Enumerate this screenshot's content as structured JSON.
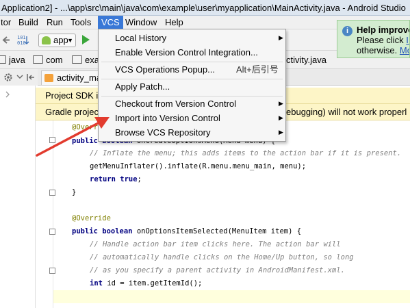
{
  "window": {
    "title": "Application2] - ...\\app\\src\\main\\java\\com\\example\\user\\myapplication\\MainActivity.java - Android Studio"
  },
  "menubar": {
    "items": [
      "tor",
      "Build",
      "Run",
      "Tools",
      "VCS",
      "Window",
      "Help"
    ]
  },
  "toolbar": {
    "run_config": "app"
  },
  "breadcrumbs": {
    "items": [
      "java",
      "com",
      "exa",
      "ctivity.java"
    ]
  },
  "editor_tab": {
    "label": "activity_ma"
  },
  "notifications": {
    "sdk": "Project SDK i",
    "gradle": "Gradle projec",
    "gradle_tail": "ebugging) will not work properl"
  },
  "help_popup": {
    "title": "Help improve",
    "line1": "Please click ",
    "line1_link": "I a",
    "line2": "otherwise. ",
    "line2_link": "Mo"
  },
  "vcs_menu": {
    "items": [
      {
        "label": "Local History",
        "has_submenu": true
      },
      {
        "label": "Enable Version Control Integration...",
        "has_submenu": false
      },
      {
        "label": "VCS Operations Popup...",
        "shortcut": "Alt+后引号",
        "has_submenu": false
      },
      {
        "label": "Apply Patch...",
        "has_submenu": false
      },
      {
        "label": "Checkout from Version Control",
        "has_submenu": true
      },
      {
        "label": "Import into Version Control",
        "has_submenu": true
      },
      {
        "label": "Browse VCS Repository",
        "has_submenu": true
      }
    ]
  },
  "code": {
    "l1": "@Overr",
    "l2_kw": "public boolean",
    "l2_rest": " onCreateOptionsMenu(Menu menu) {",
    "l3": "// Inflate the menu; this adds items to the action bar if it is present.",
    "l4": "getMenuInflater().inflate(R.menu.menu_main, menu);",
    "l5_kw": "return true",
    "l5_rest": ";",
    "l6": "}",
    "l7": "@Override",
    "l8_kw": "public boolean",
    "l8_rest": " onOptionsItemSelected(MenuItem item) {",
    "l9": "// Handle action bar item clicks here. The action bar will",
    "l10": "// automatically handle clicks on the Home/Up button, so long",
    "l11": "// as you specify a parent activity in AndroidManifest.xml.",
    "l12_kw": "int",
    "l12_rest": " id = item.getItemId();"
  },
  "colors": {
    "menu_highlight": "#3978d7",
    "notification_bg": "#fdf5c7",
    "help_bg": "#d3ecd0",
    "arrow": "#e23b2e",
    "keyword": "#000080",
    "comment": "#808080"
  }
}
